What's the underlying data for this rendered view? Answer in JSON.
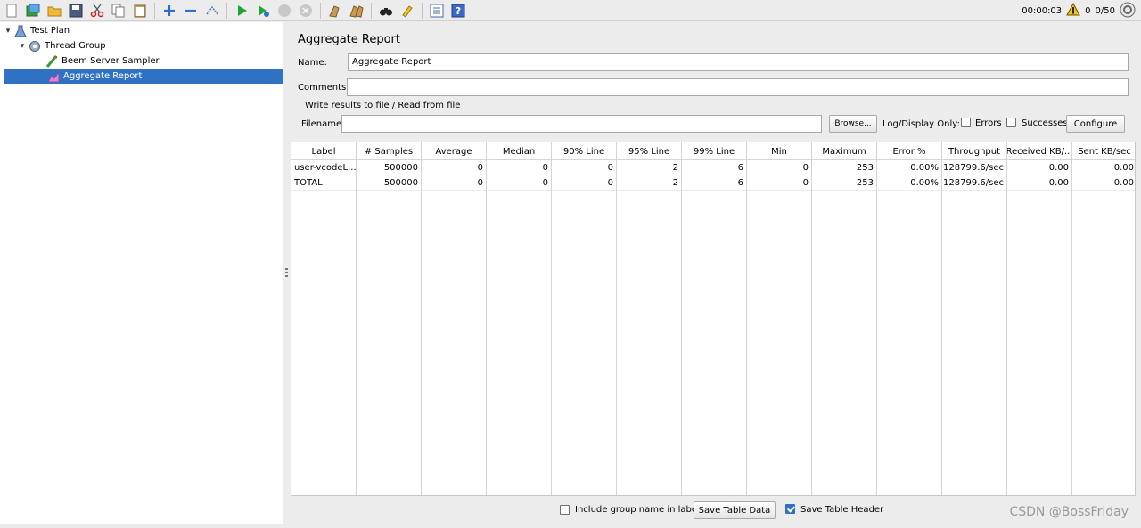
{
  "toolbar": {
    "buttons": [
      "new-icon",
      "templates-icon",
      "open-icon",
      "save-icon",
      "cut-icon",
      "copy-icon",
      "paste-icon",
      "expand-icon",
      "collapse-icon",
      "toggle-icon",
      "start-icon",
      "start-no-pause-icon",
      "stop-icon",
      "shutdown-icon",
      "clear-icon",
      "clear-all-icon",
      "search-icon",
      "reset-search-icon",
      "function-helper-icon",
      "help-icon"
    ],
    "elapsed_time": "00:00:03",
    "warning_count": "0",
    "threads": "0/50"
  },
  "tree": {
    "nodes": [
      {
        "label": "Test Plan",
        "icon": "test-plan-icon"
      },
      {
        "label": "Thread Group",
        "icon": "thread-group-icon"
      },
      {
        "label": "Beem Server Sampler",
        "icon": "sampler-icon"
      },
      {
        "label": "Aggregate Report",
        "icon": "report-icon"
      }
    ]
  },
  "panel": {
    "title": "Aggregate Report",
    "name_label": "Name:",
    "name_value": "Aggregate Report",
    "comments_label": "Comments:",
    "comments_value": "",
    "file_group_title": "Write results to file / Read from file",
    "filename_label": "Filename",
    "filename_value": "",
    "browse_label": "Browse...",
    "log_display_label": "Log/Display Only:",
    "errors_label": "Errors",
    "errors_checked": false,
    "successes_label": "Successes",
    "successes_checked": false,
    "configure_label": "Configure"
  },
  "table": {
    "headers": [
      "Label",
      "# Samples",
      "Average",
      "Median",
      "90% Line",
      "95% Line",
      "99% Line",
      "Min",
      "Maximum",
      "Error %",
      "Throughput",
      "Received KB/...",
      "Sent KB/sec"
    ],
    "rows": [
      [
        "user-vcodeL...",
        "500000",
        "0",
        "0",
        "0",
        "2",
        "6",
        "0",
        "253",
        "0.00%",
        "128799.6/sec",
        "0.00",
        "0.00"
      ],
      [
        "TOTAL",
        "500000",
        "0",
        "0",
        "0",
        "2",
        "6",
        "0",
        "253",
        "0.00%",
        "128799.6/sec",
        "0.00",
        "0.00"
      ]
    ]
  },
  "bottom": {
    "include_group_label": "Include group name in label?",
    "include_group_checked": false,
    "save_table_data_label": "Save Table Data",
    "save_table_header_label": "Save Table Header",
    "save_table_header_checked": true
  },
  "watermark": "CSDN @BossFriday"
}
